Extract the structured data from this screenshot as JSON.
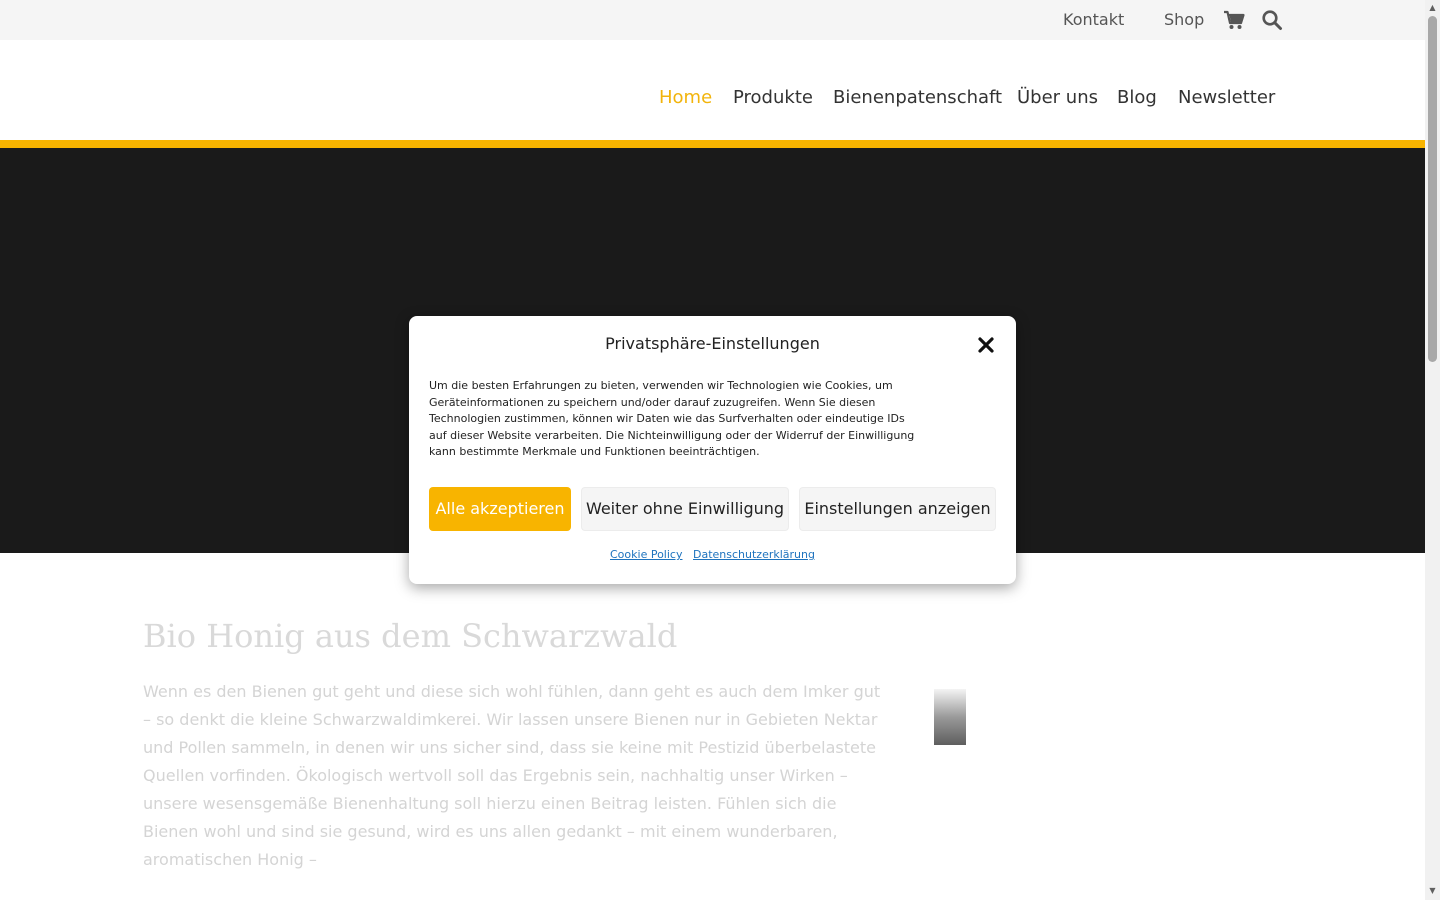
{
  "topbar": {
    "kontakt": "Kontakt",
    "shop": "Shop",
    "cart_icon": "shopping-cart-icon",
    "search_icon": "search-icon"
  },
  "nav": {
    "items": [
      {
        "label": "Home",
        "active": true
      },
      {
        "label": "Produkte"
      },
      {
        "label": "Bienenpatenschaft"
      },
      {
        "label": "Über uns"
      },
      {
        "label": "Blog"
      },
      {
        "label": "Newsletter"
      }
    ]
  },
  "content": {
    "title": "Bio Honig aus dem Schwarzwald",
    "paragraph": "Wenn es den Bienen gut geht und diese sich wohl fühlen, dann geht es auch dem Imker gut – so denkt die kleine Schwarzwaldimkerei. Wir lassen unsere Bienen nur in Gebieten Nektar und Pollen sammeln, in denen wir uns sicher sind, dass sie keine mit Pestizid überbelastete Quellen vorfinden. Ökologisch wertvoll soll das Ergebnis sein, nachhaltig unser Wirken – unsere wesensgemäße Bienenhaltung soll hierzu einen Beitrag leisten. Fühlen sich die Bienen wohl und sind sie gesund, wird es uns allen gedankt – mit einem wunderbaren, aromatischen Honig –"
  },
  "cookie_modal": {
    "title": "Privatsphäre-Einstellungen",
    "text": "Um die besten Erfahrungen zu bieten, verwenden wir Technologien wie Cookies, um Geräteinformationen zu speichern und/oder darauf zuzugreifen. Wenn Sie diesen Technologien zustimmen, können wir Daten wie das Surfverhalten oder eindeutige IDs auf dieser Website verarbeiten. Die Nichteinwilligung oder der Widerruf der Einwilligung kann bestimmte Merkmale und Funktionen beeinträchtigen.",
    "accept_all": "Alle akzeptieren",
    "continue_without": "Weiter ohne Einwilligung",
    "show_settings": "Einstellungen anzeigen",
    "cookie_policy": "Cookie Policy",
    "privacy": "Datenschutzerklärung"
  },
  "colors": {
    "accent": "#f8b400",
    "hero_bg": "#1a1a1a",
    "link": "#1e73be"
  }
}
